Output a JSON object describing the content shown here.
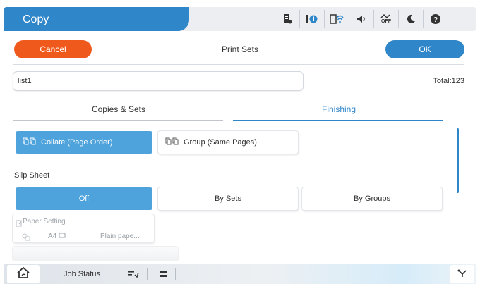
{
  "header": {
    "title": "Copy",
    "status_icons": [
      "document-settings-icon",
      "info-icon",
      "wifi-icon",
      "volume-icon",
      "network-off-icon",
      "sleep-icon",
      "help-icon"
    ],
    "network_off_text": "OFF"
  },
  "toolbar": {
    "cancel_label": "Cancel",
    "page_title": "Print Sets",
    "ok_label": "OK"
  },
  "list_name": {
    "value": "list1"
  },
  "total": "Total:123",
  "tabs": [
    {
      "label": "Copies & Sets",
      "active": false
    },
    {
      "label": "Finishing",
      "active": true
    }
  ],
  "collate_options": [
    {
      "label": "Collate (Page Order)",
      "selected": true,
      "icon": "collate-icon"
    },
    {
      "label": "Group (Same Pages)",
      "selected": false,
      "icon": "group-icon"
    }
  ],
  "slip_sheet": {
    "label": "Slip Sheet",
    "options": [
      {
        "label": "Off",
        "selected": true
      },
      {
        "label": "By Sets",
        "selected": false
      },
      {
        "label": "By Groups",
        "selected": false
      }
    ]
  },
  "paper_setting": {
    "label": "Paper Setting",
    "size": "A4",
    "type": "Plain pape..."
  },
  "bottom_bar": {
    "job_status_label": "Job Status",
    "icons": [
      "home-icon",
      "job-stop-icon",
      "stop-icon",
      "connect-icon"
    ]
  },
  "colors": {
    "accent": "#2f86c9",
    "cancel": "#ef5a1c",
    "selected": "#4fa3dc"
  }
}
